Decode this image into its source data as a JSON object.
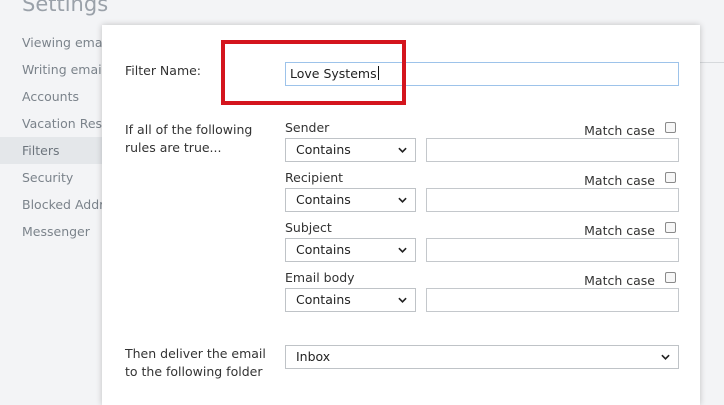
{
  "page": {
    "title": "Settings"
  },
  "sidebar": {
    "items": [
      {
        "label": "Viewing email",
        "active": false
      },
      {
        "label": "Writing email",
        "active": false
      },
      {
        "label": "Accounts",
        "active": false
      },
      {
        "label": "Vacation Response",
        "active": false
      },
      {
        "label": "Filters",
        "active": true
      },
      {
        "label": "Security",
        "active": false
      },
      {
        "label": "Blocked Addresses",
        "active": false
      },
      {
        "label": "Messenger",
        "active": false
      }
    ]
  },
  "filter": {
    "name_label": "Filter Name:",
    "name_value": "Love Systems",
    "rules_label_line1": "If all of the following",
    "rules_label_line2": "rules are true...",
    "rules": [
      {
        "field": "Sender",
        "operator": "Contains",
        "value": "",
        "match_case_label": "Match case",
        "match_case": false
      },
      {
        "field": "Recipient",
        "operator": "Contains",
        "value": "",
        "match_case_label": "Match case",
        "match_case": false
      },
      {
        "field": "Subject",
        "operator": "Contains",
        "value": "",
        "match_case_label": "Match case",
        "match_case": false
      },
      {
        "field": "Email body",
        "operator": "Contains",
        "value": "",
        "match_case_label": "Match case",
        "match_case": false
      }
    ],
    "deliver_label_line1": "Then deliver the email",
    "deliver_label_line2": "to the following folder",
    "deliver_folder": "Inbox"
  },
  "colors": {
    "highlight": "#d4151d",
    "active_nav_bg": "#e4e7ea",
    "focus_border": "#9dc3ea"
  }
}
